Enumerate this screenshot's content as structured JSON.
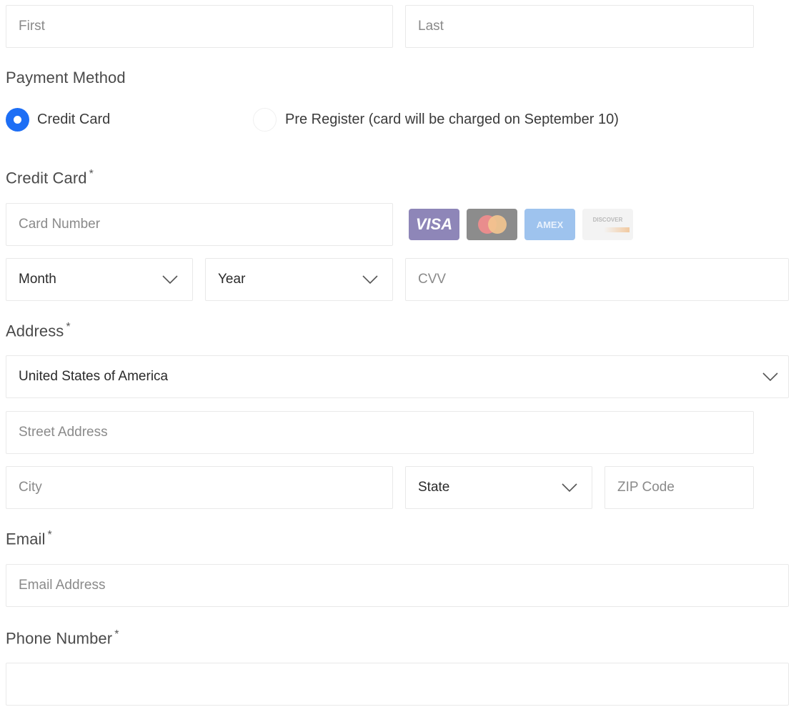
{
  "name": {
    "first_placeholder": "First",
    "last_placeholder": "Last"
  },
  "payment": {
    "label": "Payment Method",
    "options": [
      {
        "label": "Credit Card",
        "selected": true
      },
      {
        "label": "Pre Register (card will be charged on September 10)",
        "selected": false
      }
    ],
    "accent_color": "#1d6ef5"
  },
  "credit_card": {
    "label": "Credit Card",
    "required_mark": "*",
    "number_placeholder": "Card Number",
    "month_value": "Month",
    "year_value": "Year",
    "cvv_placeholder": "CVV",
    "logos": [
      {
        "name": "visa-logo-icon",
        "text": "VISA",
        "color": "#8e86b8"
      },
      {
        "name": "mastercard-logo-icon",
        "text": "",
        "color": "#8c8c8c"
      },
      {
        "name": "amex-logo-icon",
        "text": "AMEX",
        "color": "#9ec3ee"
      },
      {
        "name": "discover-logo-icon",
        "text": "DISCOVER",
        "color": "#f0f0f0"
      }
    ]
  },
  "address": {
    "label": "Address",
    "required_mark": "*",
    "country_value": "United States of America",
    "street_placeholder": "Street Address",
    "city_placeholder": "City",
    "state_value": "State",
    "zip_placeholder": "ZIP Code"
  },
  "email": {
    "label": "Email",
    "required_mark": "*",
    "placeholder": "Email Address"
  },
  "phone": {
    "label": "Phone Number",
    "required_mark": "*",
    "placeholder": ""
  }
}
